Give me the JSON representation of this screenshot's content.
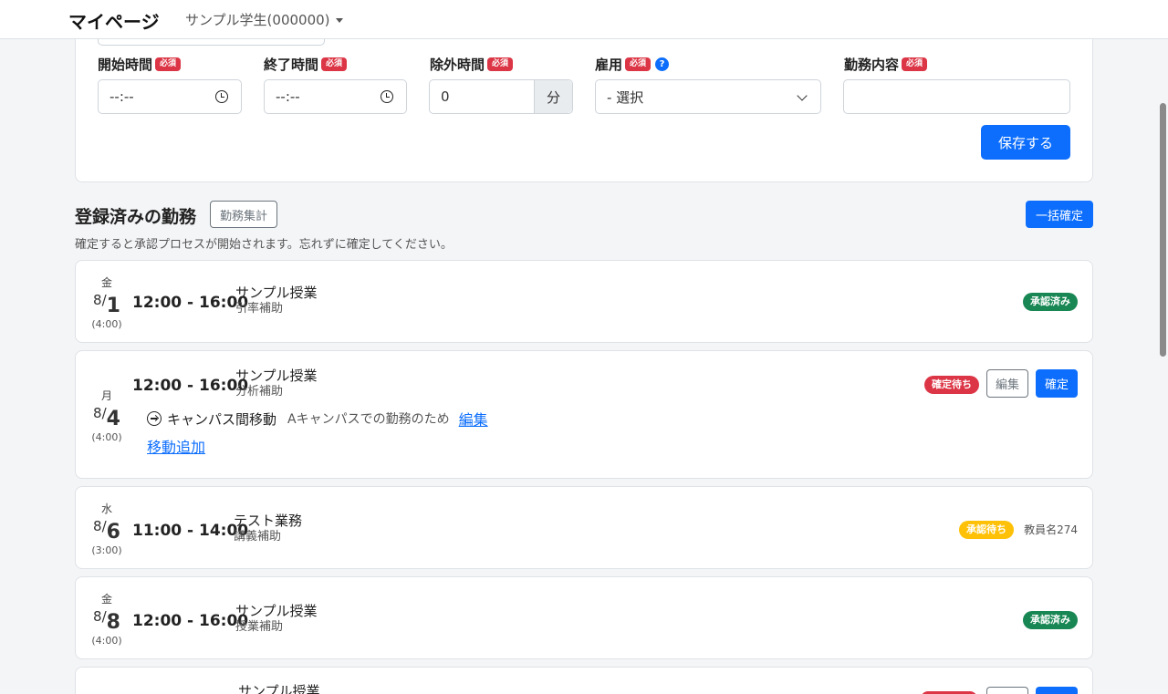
{
  "navbar": {
    "brand": "マイページ",
    "user": "サンプル学生(000000)"
  },
  "form": {
    "start": {
      "label": "開始時間",
      "placeholder": "--:--"
    },
    "end": {
      "label": "終了時間",
      "placeholder": "--:--"
    },
    "exclude": {
      "label": "除外時間",
      "value": "0",
      "unit": "分"
    },
    "employment": {
      "label": "雇用",
      "help": "?",
      "selected": "- 選択"
    },
    "content": {
      "label": "勤務内容",
      "value": ""
    },
    "required": "必須",
    "save": "保存する"
  },
  "section": {
    "title": "登録済みの勤務",
    "summary_button": "勤務集計",
    "bulk_confirm": "一括確定",
    "notice": "確定すると承認プロセスが開始されます。忘れずに確定してください。"
  },
  "shifts": [
    {
      "dow": "金",
      "month": "8/",
      "day": "1",
      "duration": "(4:00)",
      "time": "12:00 - 16:00",
      "subject": "サンプル授業",
      "role": "引率補助",
      "status": "承認済み"
    },
    {
      "dow": "月",
      "month": "8/",
      "day": "4",
      "duration": "(4:00)",
      "time": "12:00 - 16:00",
      "subject": "サンプル授業",
      "role": "分析補助",
      "status": "確定待ち",
      "edit": "編集",
      "confirm": "確定",
      "move": {
        "label": "キャンパス間移動",
        "reason": "Aキャンパスでの勤務のため",
        "edit": "編集",
        "add": "移動追加"
      }
    },
    {
      "dow": "水",
      "month": "8/",
      "day": "6",
      "duration": "(3:00)",
      "time": "11:00 - 14:00",
      "subject": "テスト業務",
      "role": "講義補助",
      "status": "承認待ち",
      "teacher": "教員名274"
    },
    {
      "dow": "金",
      "month": "8/",
      "day": "8",
      "duration": "(4:00)",
      "time": "12:00 - 16:00",
      "subject": "サンプル授業",
      "role": "授業補助",
      "status": "承認済み"
    },
    {
      "subject": "サンプル授業"
    }
  ]
}
